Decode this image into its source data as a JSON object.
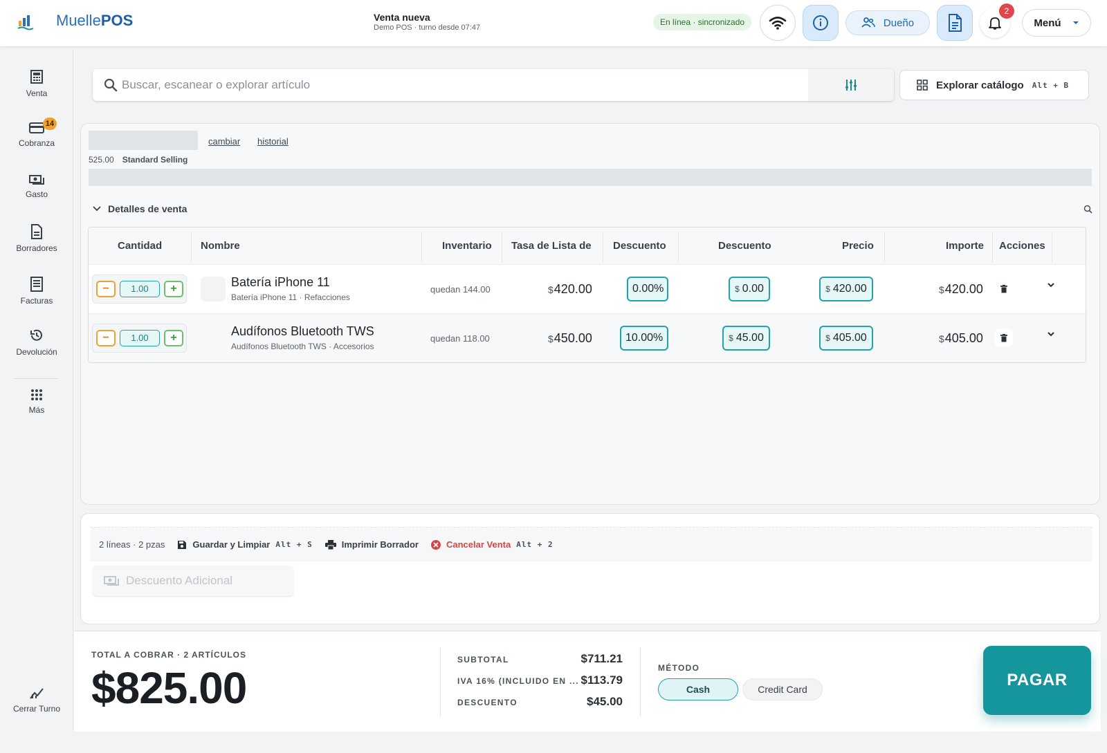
{
  "app": {
    "name_part1": "Muelle",
    "name_part2": "POS"
  },
  "header": {
    "title": "Venta nueva",
    "subtitle": "Demo POS · turno desde 07:47",
    "status": "En línea · sincronizado",
    "owner_label": "Dueño",
    "notifications_count": "2",
    "menu_label": "Menú"
  },
  "sidebar": {
    "items": [
      {
        "label": "Venta",
        "icon": "register-icon"
      },
      {
        "label": "Cobranza",
        "icon": "card-icon",
        "badge": "14"
      },
      {
        "label": "Gasto",
        "icon": "cash-icon"
      },
      {
        "label": "Borradores",
        "icon": "document-icon"
      },
      {
        "label": "Facturas",
        "icon": "invoice-icon"
      },
      {
        "label": "Devolución",
        "icon": "return-icon"
      },
      {
        "label": "Más",
        "icon": "apps-icon"
      }
    ],
    "close_shift": "Cerrar Turno"
  },
  "search": {
    "placeholder": "Buscar, escanear o explorar artículo",
    "catalog_label": "Explorar catálogo",
    "catalog_shortcut": "Alt + B"
  },
  "customer": {
    "link_change": "cambiar",
    "link_history": "historial",
    "balance": "525.00",
    "price_list": "Standard Selling"
  },
  "details_label": "Detalles de venta",
  "table": {
    "headers": [
      "Cantidad",
      "Nombre",
      "Inventario",
      "Tasa de Lista de",
      "Descuento",
      "Descuento",
      "Precio",
      "Importe",
      "Acciones"
    ],
    "rows": [
      {
        "qty": "1.00",
        "name": "Batería iPhone 11",
        "sub": "Batería iPhone 11 · Refacciones",
        "stock": "quedan 144.00",
        "list_rate": "420.00",
        "discount_pct": "0.00%",
        "discount_amt": "0.00",
        "price": "420.00",
        "amount": "420.00"
      },
      {
        "qty": "1.00",
        "name": "Audífonos Bluetooth TWS",
        "sub": "Audífonos Bluetooth TWS · Accesorios",
        "stock": "quedan 118.00",
        "list_rate": "450.00",
        "discount_pct": "10.00%",
        "discount_amt": "45.00",
        "price": "405.00",
        "amount": "405.00"
      }
    ],
    "currency_symbol": "$"
  },
  "actions": {
    "summary": "2 líneas · 2 pzas",
    "save": "Guardar y Limpiar",
    "save_shortcut": "Alt + S",
    "print": "Imprimir Borrador",
    "cancel": "Cancelar Venta",
    "cancel_shortcut": "Alt + 2",
    "extra_discount_placeholder": "Descuento Adicional"
  },
  "totals": {
    "caption": "TOTAL A COBRAR · 2 ARTÍCULOS",
    "total": "$825.00",
    "subtotal_label": "SUBTOTAL",
    "subtotal": "$711.21",
    "tax_label": "IVA 16% (INCLUIDO EN ...",
    "tax": "$113.79",
    "discount_label": "DESCUENTO",
    "discount": "$45.00",
    "method_label": "MÉTODO",
    "methods": [
      "Cash",
      "Credit Card"
    ],
    "pay_label": "PAGAR"
  },
  "colors": {
    "accent": "#14969c",
    "brand": "#2b6fb6",
    "danger": "#d64545",
    "warning": "#f0a22e"
  }
}
